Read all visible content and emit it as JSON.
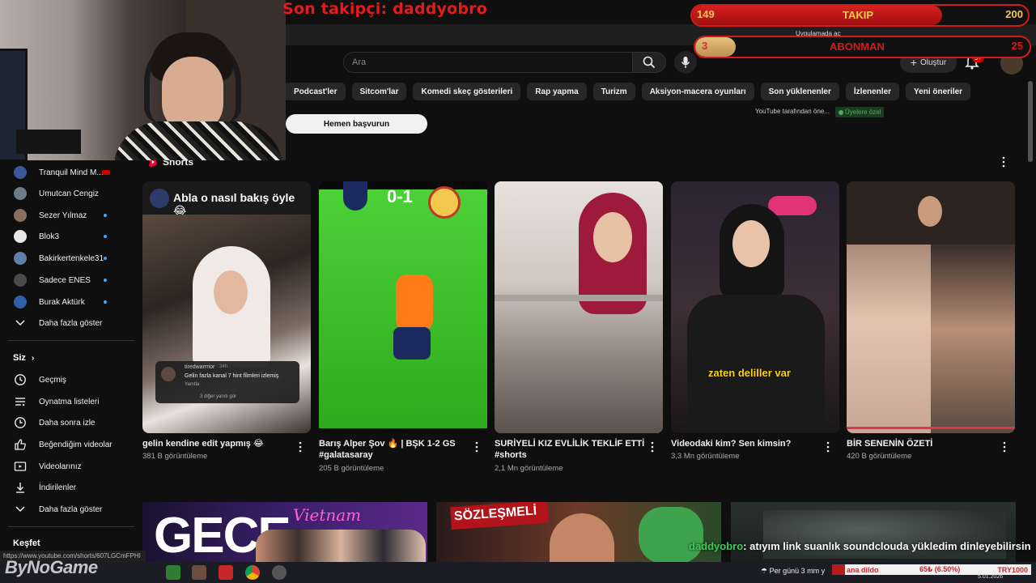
{
  "overlay": {
    "last_follower": "Son takipçi: daddyobro",
    "follow_goal": {
      "current": "149",
      "label": "TAKIP",
      "target": "200",
      "progress": 0.745
    },
    "sub_goal": {
      "current": "3",
      "label": "ABONMAN",
      "target": "25",
      "progress": 0.12
    },
    "chat_user": "daddyobro",
    "chat_message": ": atıyım link suanlık soundclouda yükledim dinleyebilirsin",
    "watermark": "ByNoGame"
  },
  "header": {
    "search_placeholder": "Ara",
    "create_label": "Oluştur",
    "notif_badge": "9+",
    "browser_hint": "Uygulamada aç"
  },
  "chips": [
    "Podcast'ler",
    "Sitcom'lar",
    "Komedi skeç gösterileri",
    "Rap yapma",
    "Turizm",
    "Aksiyon-macera oyunları",
    "Son yüklenenler",
    "İzlenenler",
    "Yeni öneriler"
  ],
  "promo": {
    "apply_button": "Hemen başvurun",
    "offer_text": "YouTube tarafından öne...",
    "members_badge": "Üyelere özel"
  },
  "sidebar": {
    "subscriptions": [
      {
        "name": "Tranquil Mind M...",
        "color": "#3b5998"
      },
      {
        "name": "Umutcan Cengiz",
        "color": "#6d7b8a"
      },
      {
        "name": "Sezer Yılmaz",
        "color": "#8a6d5b"
      },
      {
        "name": "Blok3",
        "color": "#e8e8e8"
      },
      {
        "name": "Bakirkertenkele31",
        "color": "#5e7fa8"
      },
      {
        "name": "Sadece ENES",
        "color": "#4a4a4a"
      },
      {
        "name": "Burak Aktürk",
        "color": "#2f5fa8"
      }
    ],
    "show_more": "Daha fazla göster",
    "you_header": "Siz",
    "you_items": [
      {
        "label": "Geçmiş",
        "icon": "history-icon"
      },
      {
        "label": "Oynatma listeleri",
        "icon": "playlist-icon"
      },
      {
        "label": "Daha sonra izle",
        "icon": "watch-later-icon"
      },
      {
        "label": "Beğendiğim videolar",
        "icon": "like-icon"
      },
      {
        "label": "Videolarınız",
        "icon": "your-videos-icon"
      },
      {
        "label": "İndirilenler",
        "icon": "download-icon"
      }
    ],
    "show_more_2": "Daha fazla göster",
    "explore_header": "Keşfet"
  },
  "shorts": {
    "section_title": "Shorts",
    "items": [
      {
        "title_line1": "gelin kendine edit yapmış 😂",
        "title_line2": "",
        "views": "381 B görüntüleme",
        "overlay_text": "Abla o nasıl bakış öyle 😂"
      },
      {
        "title_line1": "Barış Alper Şov 🔥 | BŞK 1-2 GS",
        "title_line2": "#galatasaray",
        "views": "205 B görüntüleme",
        "overlay_text": "0-1"
      },
      {
        "title_line1": "SURİYELİ KIZ EVLİLİK TEKLİF ETTİ",
        "title_line2": "#shorts",
        "views": "2,1 Mn görüntüleme",
        "overlay_text": ""
      },
      {
        "title_line1": "Videodaki kim? Sen kimsin?",
        "title_line2": "",
        "views": "3,3 Mn görüntüleme",
        "overlay_text": "zaten deliller var"
      },
      {
        "title_line1": "BİR SENENİN ÖZETİ",
        "title_line2": "",
        "views": "420 B görüntüleme",
        "overlay_text": ""
      }
    ],
    "comment_bubble": {
      "user": "tiredwarrrior",
      "time": "34h",
      "text": "Gelin fazla kanal 7 hint filmleri izlemiş",
      "reply": "Yanıtla",
      "more": "3 diğer yanıtı gör"
    }
  },
  "thumbnails": [
    {
      "text1": "GECE",
      "text2": "Vietnam"
    },
    {
      "text1": "SÖZLEŞMELİ"
    },
    {
      "text1": ""
    }
  ],
  "status_url": "https://www.youtube.com/shorts/607LGCmFPHI",
  "taskbar": {
    "weather": "Per günü 3 mm y",
    "ticker_1": "ana dildo",
    "ticker_2": "65₺ (6.50%)",
    "ticker_3": "TRY1000",
    "date": "5.01.2026"
  }
}
